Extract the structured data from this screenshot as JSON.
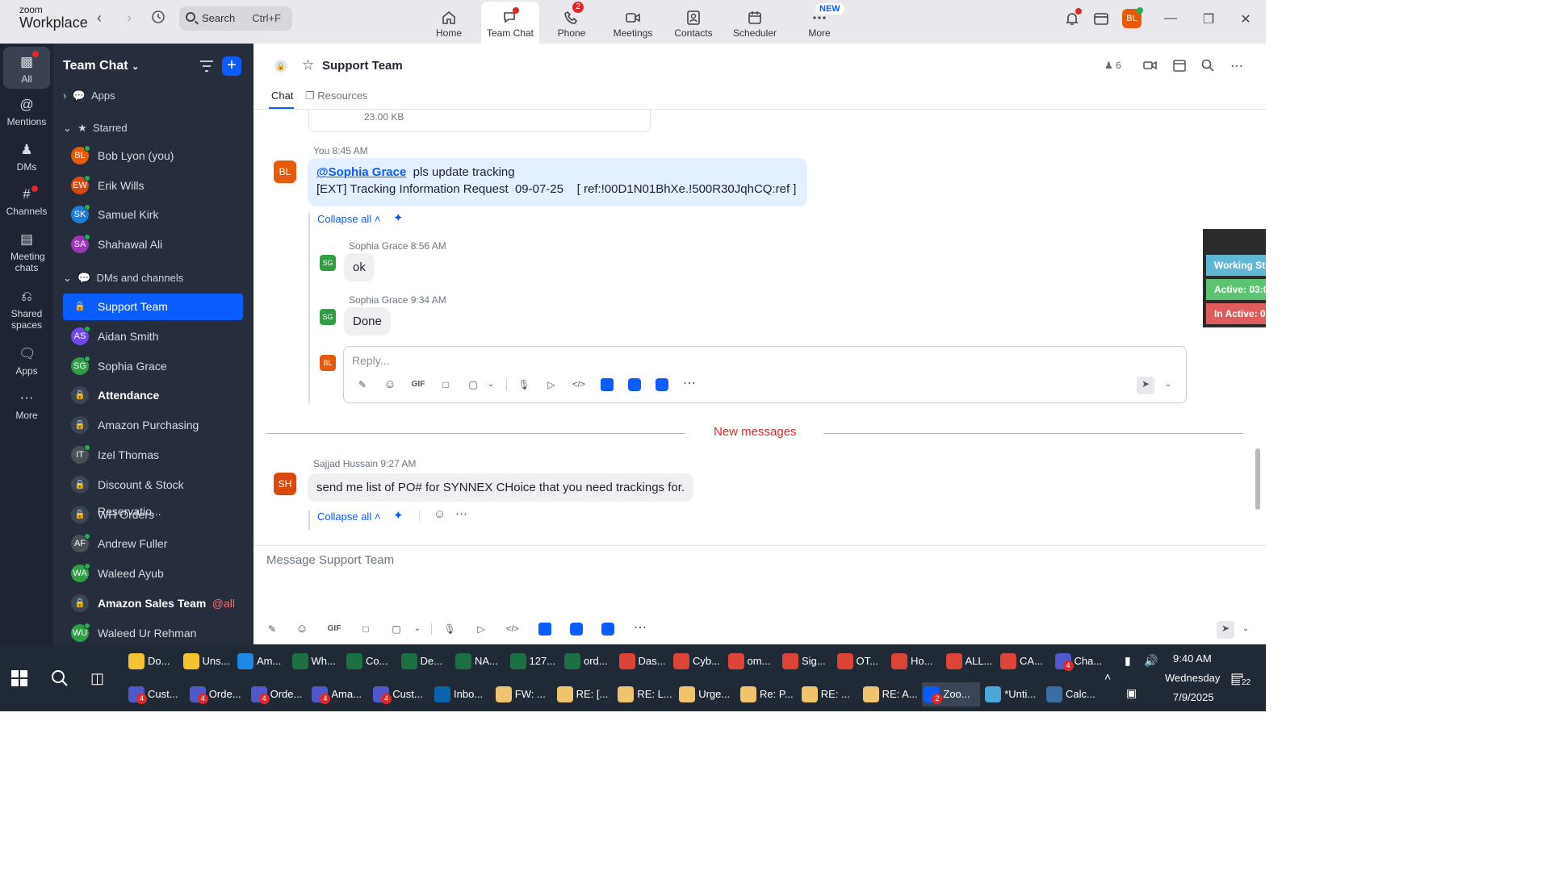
{
  "app": {
    "logo_top": "zoom",
    "logo_bottom": "Workplace"
  },
  "search": {
    "label": "Search",
    "shortcut": "Ctrl+F"
  },
  "tabs": [
    {
      "label": "Home",
      "icon": "home-icon"
    },
    {
      "label": "Team Chat",
      "icon": "chat-icon"
    },
    {
      "label": "Phone",
      "icon": "phone-icon",
      "badge": "2"
    },
    {
      "label": "Meetings",
      "icon": "video-icon"
    },
    {
      "label": "Contacts",
      "icon": "contacts-icon"
    },
    {
      "label": "Scheduler",
      "icon": "calendar-icon"
    },
    {
      "label": "More",
      "icon": "more-icon",
      "tag": "NEW"
    }
  ],
  "profile": {
    "initials": "BL",
    "color": "#e8590c"
  },
  "rail": [
    {
      "label": "All",
      "icon": "chat-bubble-icon"
    },
    {
      "label": "Mentions",
      "icon": "at-icon"
    },
    {
      "label": "DMs",
      "icon": "people-icon"
    },
    {
      "label": "Channels",
      "icon": "hash-icon"
    },
    {
      "label": "Meeting chats",
      "icon": "meeting-calendar-icon"
    },
    {
      "label": "Shared spaces",
      "icon": "share-icon"
    },
    {
      "label": "Apps",
      "icon": "apps-icon"
    },
    {
      "label": "More",
      "icon": "ellipsis-icon"
    }
  ],
  "sidebar": {
    "title": "Team Chat",
    "apps_label": "Apps",
    "starred_label": "Starred",
    "dms_label": "DMs and channels",
    "starred": [
      {
        "initials": "BL",
        "name": "Bob Lyon (you)",
        "color": "#e8590c"
      },
      {
        "initials": "EW",
        "name": "Erik Wills",
        "color": "#d9480f"
      },
      {
        "initials": "SK",
        "name": "Samuel Kirk",
        "color": "#1c7ed6"
      },
      {
        "initials": "SA",
        "name": "Shahawal Ali",
        "color": "#9c36b5"
      }
    ],
    "items": [
      {
        "type": "lock",
        "name": "Support Team",
        "selected": true
      },
      {
        "type": "avatar",
        "initials": "AS",
        "name": "Aidan Smith",
        "color": "#7048e8"
      },
      {
        "type": "avatar",
        "initials": "SG",
        "name": "Sophia Grace",
        "color": "#2f9e44"
      },
      {
        "type": "lock",
        "name": "Attendance",
        "bold": true
      },
      {
        "type": "lock",
        "name": "Amazon Purchasing"
      },
      {
        "type": "avatar",
        "initials": "IT",
        "name": "Izel Thomas",
        "color": "#495057"
      },
      {
        "type": "lock",
        "name": "Discount & Stock Reservatio..."
      },
      {
        "type": "lock",
        "name": "WH Orders"
      },
      {
        "type": "avatar",
        "initials": "AF",
        "name": "Andrew Fuller",
        "color": "#495057"
      },
      {
        "type": "avatar",
        "initials": "WA",
        "name": "Waleed Ayub",
        "color": "#2f9e44"
      },
      {
        "type": "lock",
        "name": "Amazon Sales Team",
        "bold": true,
        "tag": "@all"
      },
      {
        "type": "avatar",
        "initials": "WU",
        "name": "Waleed Ur Rehman",
        "color": "#2f9e44"
      }
    ]
  },
  "channel": {
    "title": "Support Team",
    "member_count": "6",
    "tab_chat": "Chat",
    "tab_resources": "Resources"
  },
  "messages": {
    "file_size": "23.00 KB",
    "m1_author": "You",
    "m1_time": "8:45 AM",
    "m1_initials": "BL",
    "m1_mention": "@Sophia Grace",
    "m1_text": "pls update tracking",
    "m1_line2": "[EXT] Tracking Information Request  09-07-25    [ ref:!00D1N01BhXe.!500R30JqhCQ:ref ]",
    "collapse": "Collapse all",
    "r1_author": "Sophia Grace",
    "r1_time": "8:56 AM",
    "r1_text": "ok",
    "r2_author": "Sophia Grace",
    "r2_time": "9:34 AM",
    "r2_text": "Done",
    "reply_placeholder": "Reply...",
    "new_messages": "New messages",
    "m2_author": "Sajjad Hussain",
    "m2_time": "9:27 AM",
    "m2_initials": "SH",
    "m2_text": "send me list of PO# for SYNNEX CHoice that you need trackings for.",
    "sg_initials": "SG",
    "bl_initials": "BL"
  },
  "composer": {
    "placeholder": "Message Support Team",
    "gif": "GIF"
  },
  "widget": {
    "working": "Working St",
    "active": "Active: 03:0",
    "inactive": "In Active: 0"
  },
  "taskbar": {
    "row1": [
      {
        "label": "Do...",
        "color": "#f4c430"
      },
      {
        "label": "Uns...",
        "color": "#f4c430"
      },
      {
        "label": "Am...",
        "color": "#1e88e5"
      },
      {
        "label": "Wh...",
        "color": "#1d7044"
      },
      {
        "label": "Co...",
        "color": "#1d7044"
      },
      {
        "label": "De...",
        "color": "#1d7044"
      },
      {
        "label": "NA...",
        "color": "#1d7044"
      },
      {
        "label": "127...",
        "color": "#1d7044"
      },
      {
        "label": "ord...",
        "color": "#1d7044"
      },
      {
        "label": "Das...",
        "color": "#db4437"
      },
      {
        "label": "Cyb...",
        "color": "#db4437"
      },
      {
        "label": "om...",
        "color": "#db4437"
      },
      {
        "label": "Sig...",
        "color": "#db4437"
      },
      {
        "label": "OT...",
        "color": "#db4437"
      },
      {
        "label": "Ho...",
        "color": "#db4437"
      },
      {
        "label": "ALL...",
        "color": "#db4437"
      },
      {
        "label": "CA...",
        "color": "#db4437"
      },
      {
        "label": "Cha...",
        "color": "#5059c9",
        "badge": "4"
      }
    ],
    "row2": [
      {
        "label": "Cust...",
        "color": "#5059c9",
        "badge": "4"
      },
      {
        "label": "Orde...",
        "color": "#5059c9",
        "badge": "4"
      },
      {
        "label": "Orde...",
        "color": "#5059c9",
        "badge": "4"
      },
      {
        "label": "Ama...",
        "color": "#5059c9",
        "badge": "4"
      },
      {
        "label": "Cust...",
        "color": "#5059c9",
        "badge": "4"
      },
      {
        "label": "Inbo...",
        "color": "#0a64ad"
      },
      {
        "label": "FW: ...",
        "color": "#f0c36d"
      },
      {
        "label": "RE: [...",
        "color": "#f0c36d"
      },
      {
        "label": "RE: L...",
        "color": "#f0c36d"
      },
      {
        "label": "Urge...",
        "color": "#f0c36d"
      },
      {
        "label": "Re: P...",
        "color": "#f0c36d"
      },
      {
        "label": "RE: ...",
        "color": "#f0c36d"
      },
      {
        "label": "RE: A...",
        "color": "#f0c36d"
      },
      {
        "label": "Zoo...",
        "color": "#0b5cff",
        "badge": "2",
        "active": true
      },
      {
        "label": "*Unti...",
        "color": "#4ea7d9"
      },
      {
        "label": "Calc...",
        "color": "#3a6ea5"
      }
    ],
    "time": "9:40 AM",
    "day": "Wednesday",
    "date": "7/9/2025",
    "notif": "22"
  }
}
